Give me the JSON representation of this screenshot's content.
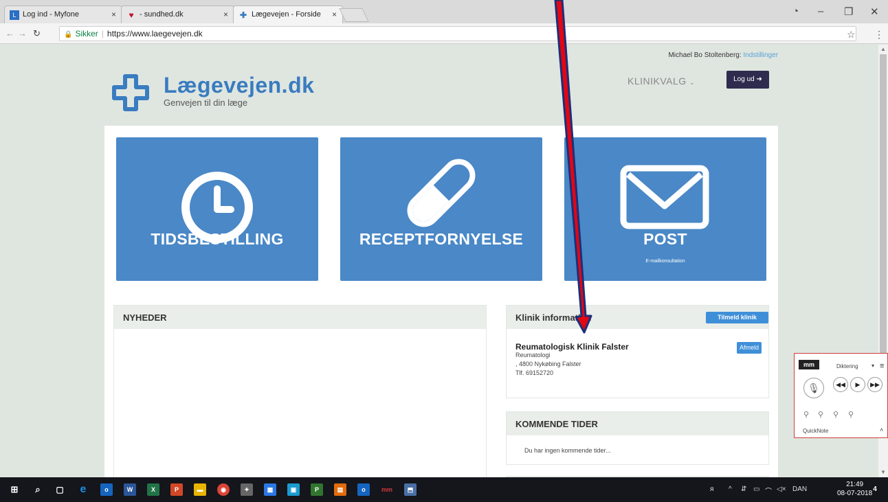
{
  "browser": {
    "tabs": [
      {
        "title": "Log ind - Myfone",
        "icon": "myfone-favicon"
      },
      {
        "title": "- sundhed.dk",
        "icon": "heart-favicon"
      },
      {
        "title": "Lægevejen - Forside",
        "icon": "cross-favicon"
      }
    ],
    "secure_label": "Sikker",
    "url": "https://www.laegevejen.dk"
  },
  "header": {
    "user_name": "Michael Bo Stoltenberg:",
    "settings_link": "Indstillinger",
    "logo_title": "Lægevejen.dk",
    "logo_subtitle": "Genvejen til din læge",
    "klinikvalg": "KLINIKVALG",
    "logout": "Log ud"
  },
  "tiles": [
    {
      "label": "TIDSBESTILLING",
      "icon": "clock-icon"
    },
    {
      "label": "RECEPTFORNYELSE",
      "icon": "pill-icon"
    },
    {
      "label": "POST",
      "sublabel": "E-mailkonsultation",
      "icon": "envelope-icon"
    }
  ],
  "news": {
    "title": "NYHEDER"
  },
  "clinic": {
    "title": "Klinik information",
    "signup": "Tilmeld klinik",
    "name": "Reumatologisk Klinik Falster",
    "specialty": "Reumatologi",
    "address": ", 4800 Nykøbing Falster",
    "phone": "Tlf. 69152720",
    "unsubscribe": "Afmeld"
  },
  "upcoming": {
    "title": "KOMMENDE TIDER",
    "empty": "Du har ingen kommende tider..."
  },
  "dictation": {
    "brand": "mm",
    "mode": "Diktering",
    "quicknote": "QuickNote"
  },
  "taskbar": {
    "language": "DAN",
    "time": "21:49",
    "date": "08-07-2018",
    "notifications": "4"
  },
  "colors": {
    "brand_blue": "#4a88c7",
    "button_blue": "#3f8fd8",
    "logout_bg": "#2f2b4f",
    "page_bg": "#dfe6e0",
    "arrow_red": "#e30613"
  }
}
